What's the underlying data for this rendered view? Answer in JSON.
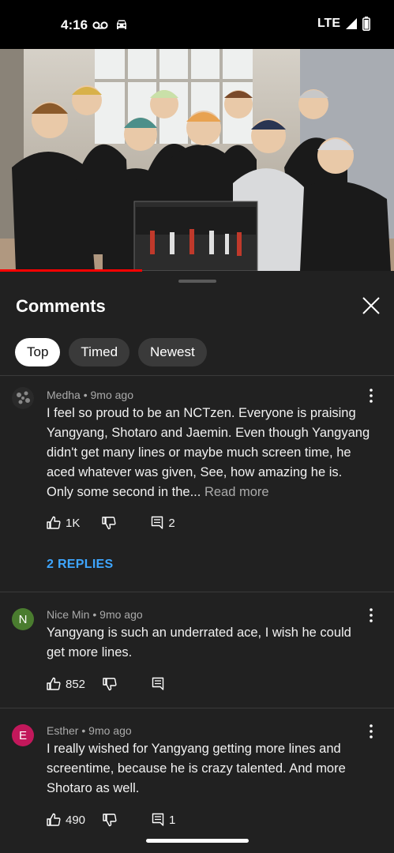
{
  "status": {
    "time": "4:16",
    "network": "LTE"
  },
  "sheet": {
    "title": "Comments",
    "chips": [
      {
        "label": "Top"
      },
      {
        "label": "Timed"
      },
      {
        "label": "Newest"
      }
    ]
  },
  "comments": [
    {
      "author": "Medha",
      "age": "9mo ago",
      "text": "I feel so proud to be an NCTzen. Everyone is praising Yangyang, Shotaro and Jaemin. Even though Yangyang didn't get many lines or maybe much screen time, he aced whatever was given, See, how amazing he is. Only some second in the...",
      "read_more": "Read more",
      "likes": "1K",
      "replies_count": "2",
      "replies_link": "2 REPLIES"
    },
    {
      "author": "Nice Min",
      "age": "9mo ago",
      "avatar_letter": "N",
      "avatar_color": "#4a7c2f",
      "text": "Yangyang is such an underrated ace, I wish he could get more lines.",
      "likes": "852"
    },
    {
      "author": "Esther",
      "age": "9mo ago",
      "avatar_letter": "E",
      "avatar_color": "#c2185b",
      "text": "I really wished for Yangyang getting more lines and screentime, because he is crazy talented. And more Shotaro as well.",
      "likes": "490",
      "replies_count": "1"
    }
  ],
  "colors": {
    "link": "#3ea6ff",
    "progress": "#ff0000",
    "background": "#212121"
  },
  "icons": [
    "voicemail-icon",
    "car-icon",
    "signal-icon",
    "battery-icon",
    "close-icon",
    "more-vert-icon",
    "thumb-up-icon",
    "thumb-down-icon",
    "reply-icon"
  ]
}
